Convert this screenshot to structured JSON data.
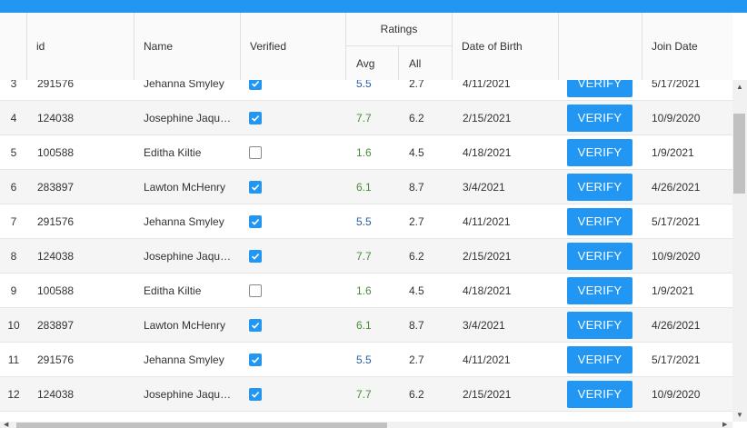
{
  "columns": {
    "id": "id",
    "name": "Name",
    "verified": "Verified",
    "ratings": "Ratings",
    "avg": "Avg",
    "all": "All",
    "dob": "Date of Birth",
    "action": "",
    "join": "Join Date"
  },
  "rows": [
    {
      "num": "3",
      "id": "291576",
      "name": "Jehanna Smyley",
      "verified": true,
      "avg": "5.5",
      "all": "2.7",
      "dob": "4/11/2021",
      "button": "VERIFY",
      "join": "5/17/2021"
    },
    {
      "num": "4",
      "id": "124038",
      "name": "Josephine Jaqu…",
      "verified": true,
      "avg": "7.7",
      "all": "6.2",
      "dob": "2/15/2021",
      "button": "VERIFY",
      "join": "10/9/2020"
    },
    {
      "num": "5",
      "id": "100588",
      "name": "Editha Kiltie",
      "verified": false,
      "avg": "1.6",
      "all": "4.5",
      "dob": "4/18/2021",
      "button": "VERIFY",
      "join": "1/9/2021"
    },
    {
      "num": "6",
      "id": "283897",
      "name": "Lawton McHenry",
      "verified": true,
      "avg": "6.1",
      "all": "8.7",
      "dob": "3/4/2021",
      "button": "VERIFY",
      "join": "4/26/2021"
    },
    {
      "num": "7",
      "id": "291576",
      "name": "Jehanna Smyley",
      "verified": true,
      "avg": "5.5",
      "all": "2.7",
      "dob": "4/11/2021",
      "button": "VERIFY",
      "join": "5/17/2021"
    },
    {
      "num": "8",
      "id": "124038",
      "name": "Josephine Jaqu…",
      "verified": true,
      "avg": "7.7",
      "all": "6.2",
      "dob": "2/15/2021",
      "button": "VERIFY",
      "join": "10/9/2020"
    },
    {
      "num": "9",
      "id": "100588",
      "name": "Editha Kiltie",
      "verified": false,
      "avg": "1.6",
      "all": "4.5",
      "dob": "4/18/2021",
      "button": "VERIFY",
      "join": "1/9/2021"
    },
    {
      "num": "10",
      "id": "283897",
      "name": "Lawton McHenry",
      "verified": true,
      "avg": "6.1",
      "all": "8.7",
      "dob": "3/4/2021",
      "button": "VERIFY",
      "join": "4/26/2021"
    },
    {
      "num": "11",
      "id": "291576",
      "name": "Jehanna Smyley",
      "verified": true,
      "avg": "5.5",
      "all": "2.7",
      "dob": "4/11/2021",
      "button": "VERIFY",
      "join": "5/17/2021"
    },
    {
      "num": "12",
      "id": "124038",
      "name": "Josephine Jaqu…",
      "verified": true,
      "avg": "7.7",
      "all": "6.2",
      "dob": "2/15/2021",
      "button": "VERIFY",
      "join": "10/9/2020"
    }
  ],
  "avg_colors": {
    "5.5": "#2a5d9f",
    "7.7": "#4a8a3c",
    "1.6": "#4a8a3c",
    "6.1": "#4a8a3c"
  },
  "colors": {
    "accent": "#2196f3",
    "row_alt": "#f5f5f5"
  },
  "scrollbar": {
    "up_icon": "arrow-up-icon",
    "down_icon": "arrow-down-icon",
    "left_icon": "arrow-left-icon",
    "right_icon": "arrow-right-icon"
  }
}
